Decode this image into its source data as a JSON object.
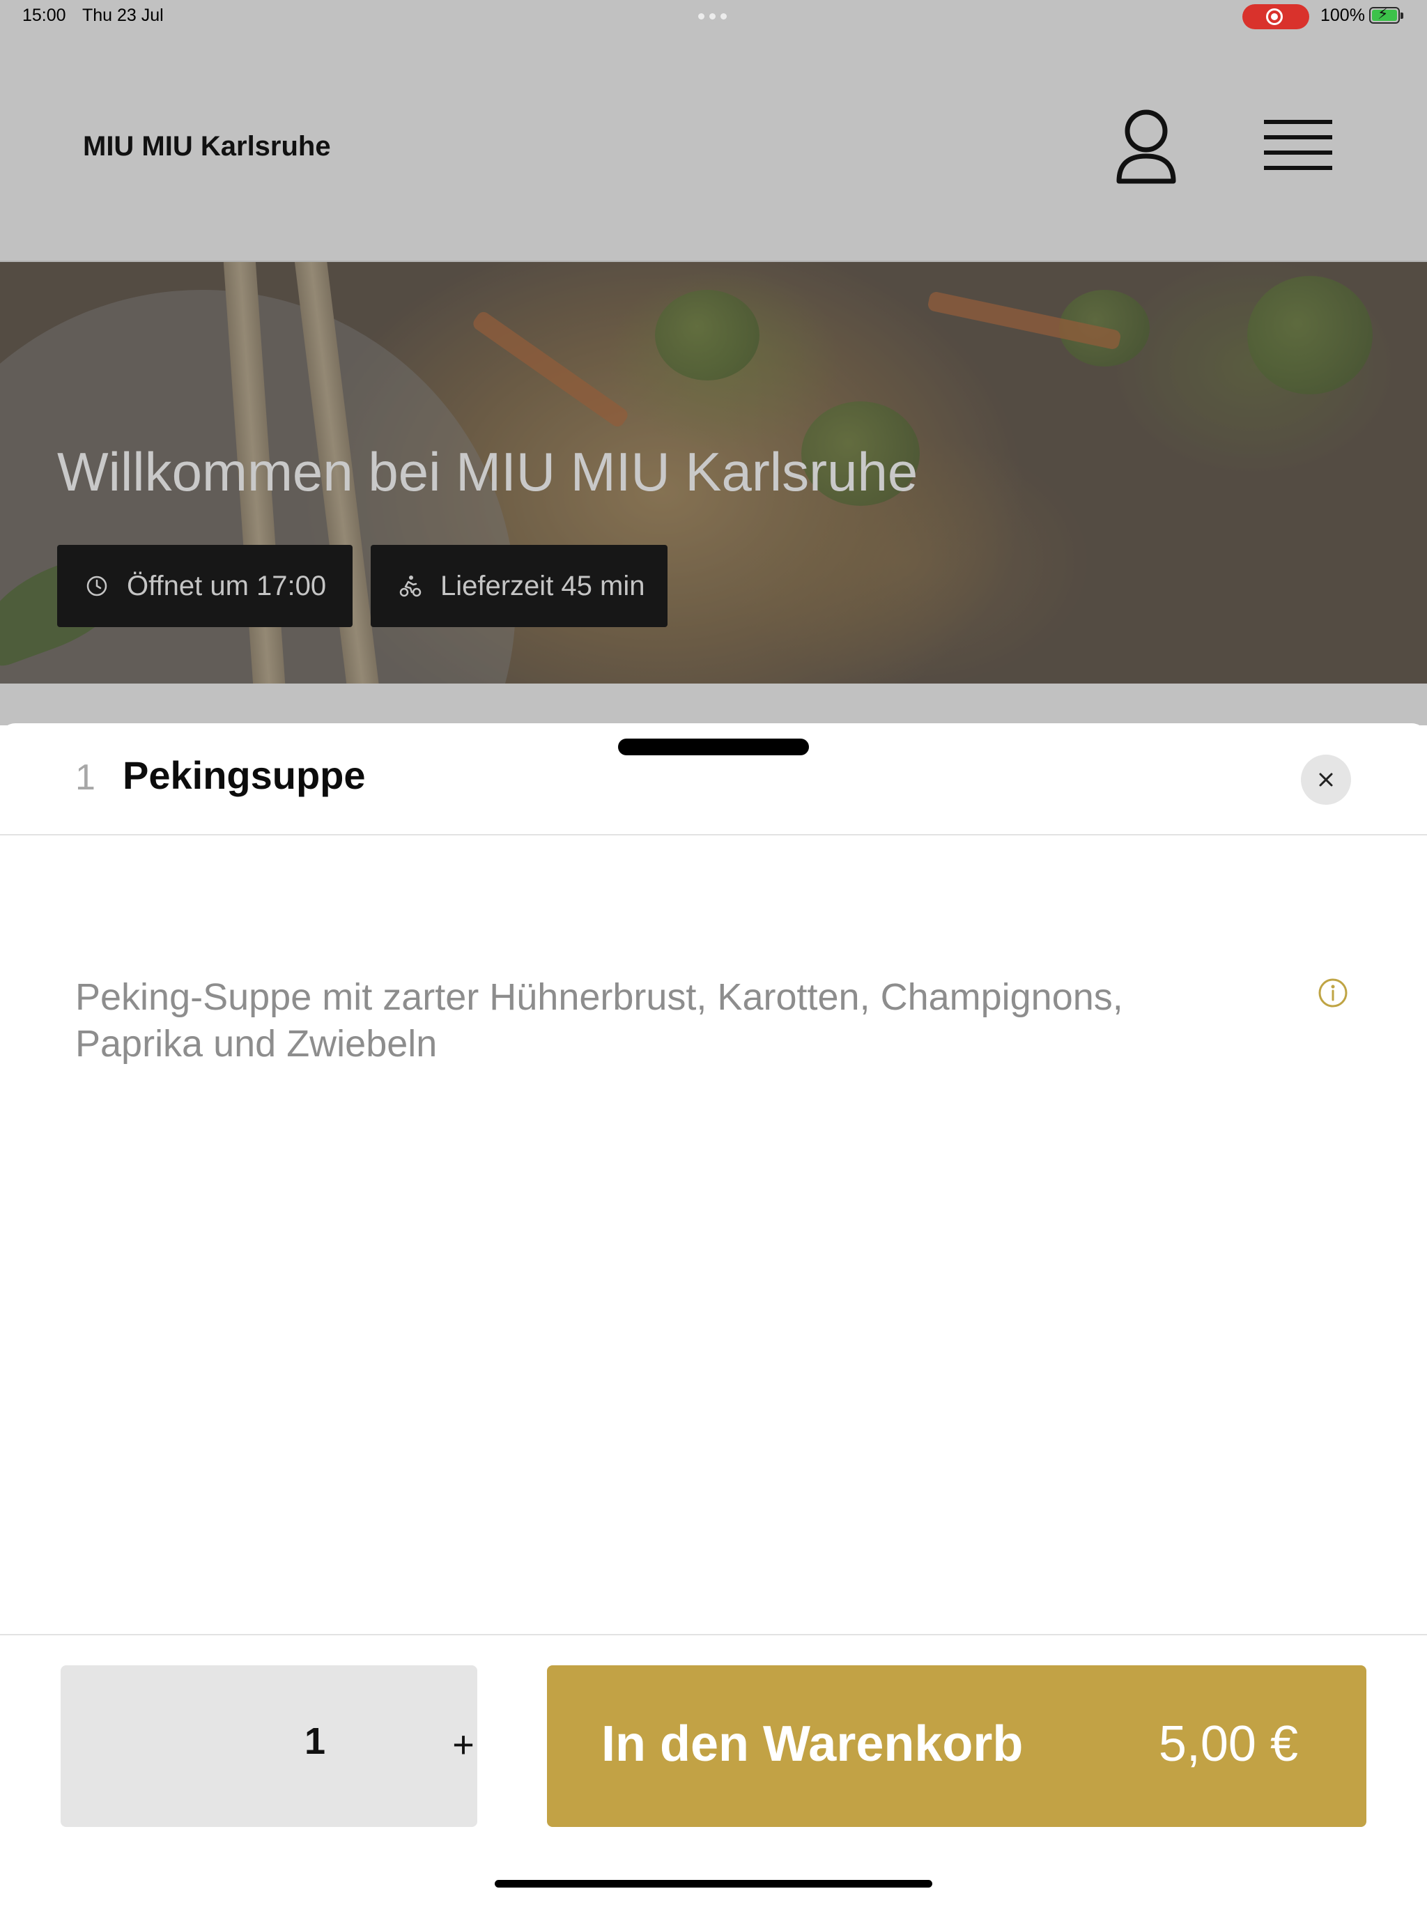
{
  "status_bar": {
    "time": "15:00",
    "date": "Thu 23 Jul",
    "battery": "100%",
    "battery_level": 1.0,
    "recording_color": "#d9322c"
  },
  "header": {
    "title": "MIU MIU Karlsruhe",
    "icons": [
      "user-icon",
      "menu-icon"
    ]
  },
  "hero": {
    "title": "Willkommen bei MIU MIU Karlsruhe",
    "opening_label": "Öffnet um 17:00",
    "opening_icon": "clock-icon",
    "delivery_label": "Lieferzeit 45 min",
    "delivery_icon": "scooter-icon"
  },
  "sheet": {
    "item_number": "1",
    "item_name": "Pekingsuppe",
    "description": "Peking-Suppe mit zarter Hühnerbrust, Karotten, Champignons, Paprika und Zwiebeln",
    "close_icon": "close-icon",
    "info_icon": "info-icon",
    "quantity": "1",
    "plus_label": "+",
    "add_to_cart_label": "In den Warenkorb",
    "price": "5,00 €"
  },
  "colors": {
    "accent": "#c2a245",
    "info_icon": "#bfa444",
    "backdrop": "#c1c1c1",
    "chip_bg": "#171717"
  }
}
